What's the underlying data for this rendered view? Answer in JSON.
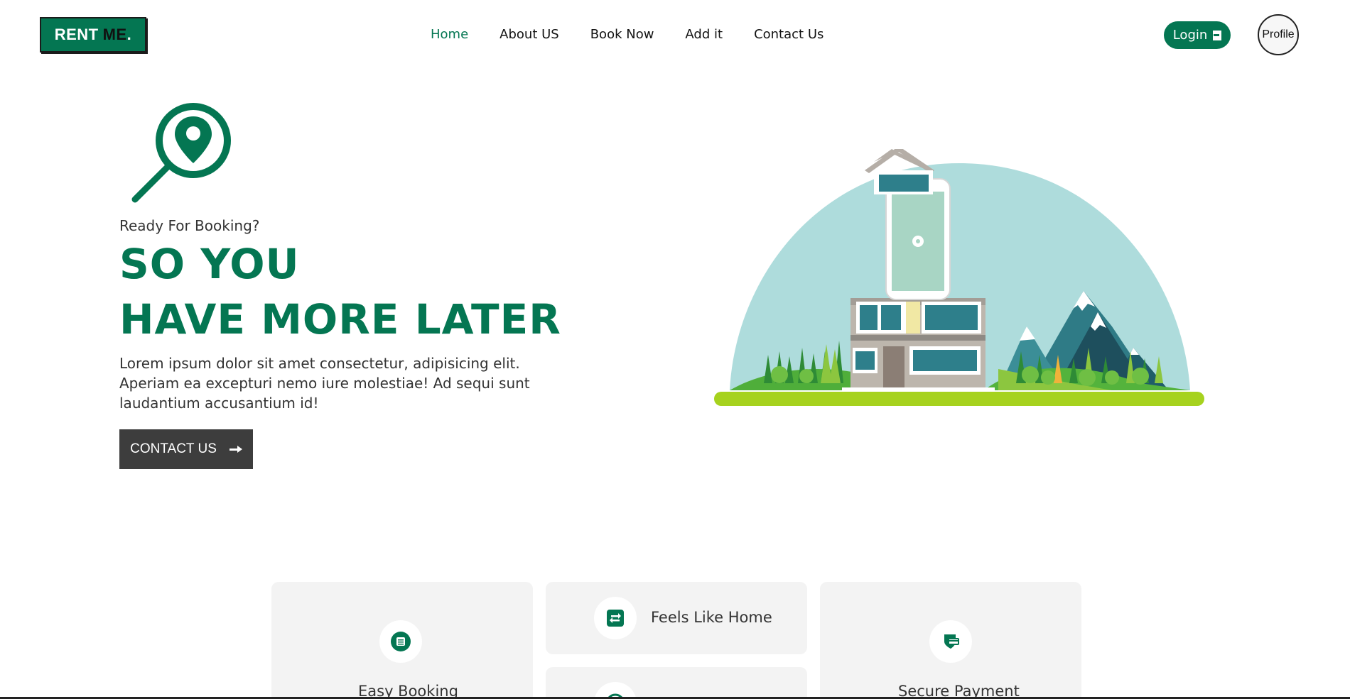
{
  "brand": {
    "part1": "RENT",
    "part2": "ME",
    "part3": "."
  },
  "nav": {
    "items": [
      {
        "label": "Home",
        "active": true
      },
      {
        "label": "About US",
        "active": false
      },
      {
        "label": "Book Now",
        "active": false
      },
      {
        "label": "Add it",
        "active": false
      },
      {
        "label": "Contact Us",
        "active": false
      }
    ]
  },
  "header": {
    "login_label": "Login",
    "profile_label": "Profile"
  },
  "hero": {
    "subtitle": "Ready For Booking?",
    "title_line1": "SO YOU",
    "title_line2": "HAVE MORE LATER",
    "description": "Lorem ipsum dolor sit amet consectetur, adipisicing elit. Aperiam ea excepturi nemo iure molestiae! Ad sequi sunt laudantium accusantium id!",
    "cta_label": "CONTACT US"
  },
  "features": [
    {
      "label": "Easy Booking",
      "icon": "book-icon"
    },
    {
      "label": "Feels Like Home",
      "icon": "exchange-icon"
    },
    {
      "label": "",
      "icon": "globe-icon"
    },
    {
      "label": "Secure Payment",
      "icon": "payment-shield-icon"
    }
  ],
  "colors": {
    "brand_green": "#047652",
    "dark_button": "#3d3d3d",
    "card_bg": "#f3f3f3",
    "sky": "#aedcdc",
    "grass": "#a6d21e"
  }
}
